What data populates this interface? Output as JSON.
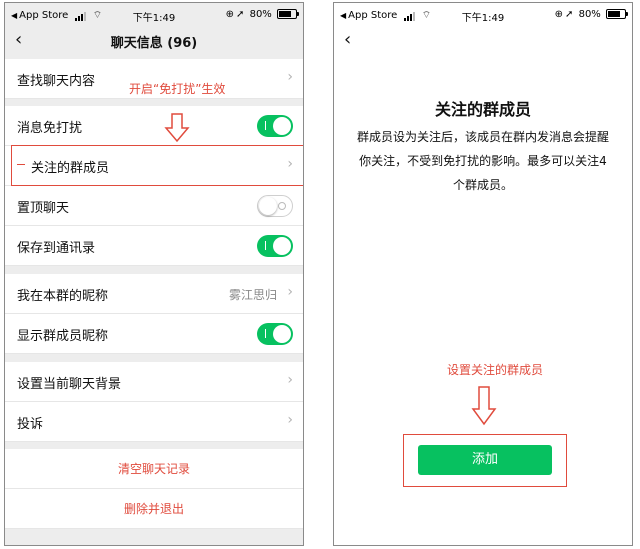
{
  "status_bar": {
    "carrier": "App Store",
    "time": "下午1:49",
    "battery": "80%"
  },
  "left": {
    "nav": {
      "title": "聊天信息 (96)",
      "back_icon": "chevron-left-icon"
    },
    "rows": {
      "search_history": "查找聊天内容",
      "mute": "消息免打扰",
      "starred_members": "关注的群成员",
      "sticky_on_top": "置顶聊天",
      "save_to_contacts": "保存到通讯录",
      "my_alias": "我在本群的昵称",
      "my_alias_value": "雾江思归",
      "show_member_alias": "显示群成员昵称",
      "set_background": "设置当前聊天背景",
      "report": "投诉",
      "clear_history": "清空聊天记录",
      "delete_and_leave": "删除并退出"
    },
    "toggles": {
      "mute": true,
      "sticky_on_top": false,
      "save_to_contacts": true,
      "show_member_alias": true
    },
    "annotation": "开启“免打扰”生效"
  },
  "right": {
    "nav": {
      "back_icon": "chevron-left-icon"
    },
    "title": "关注的群成员",
    "description": "群成员设为关注后，该成员在群内发消息会提醒你关注，不受到免打扰的影响。最多可以关注4个群成员。",
    "annotation": "设置关注的群成员",
    "add_button": "添加"
  },
  "colors": {
    "accent_green": "#07c160",
    "annotation_red": "#e04b3d",
    "group_background": "#ededed"
  }
}
